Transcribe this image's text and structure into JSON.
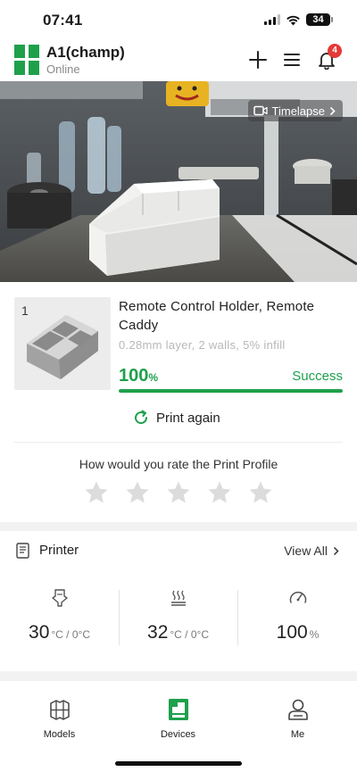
{
  "status_bar": {
    "time": "07:41",
    "battery": "34"
  },
  "header": {
    "printer_name": "A1(champ)",
    "printer_status": "Online",
    "notification_count": "4",
    "icons": [
      "add-icon",
      "menu-icon",
      "bell-icon"
    ]
  },
  "camera": {
    "timelapse_label": "Timelapse"
  },
  "job": {
    "index": "1",
    "title": "Remote Control Holder, Remote Caddy",
    "meta": "0.28mm layer, 2 walls, 5% infill",
    "progress_value": "100",
    "progress_unit": "%",
    "progress_fraction": 1.0,
    "result": "Success",
    "print_again_label": "Print again"
  },
  "rating": {
    "prompt": "How would you rate the Print Profile",
    "star_count": 5,
    "selected": 0
  },
  "printer_section": {
    "title": "Printer",
    "view_all_label": "View All",
    "temperatures": [
      {
        "icon": "nozzle-icon",
        "value": "30",
        "sub": "°C / 0°C"
      },
      {
        "icon": "heatbed-icon",
        "value": "32",
        "sub": "°C / 0°C"
      },
      {
        "icon": "fan-speed-icon",
        "value": "100",
        "sub": "%"
      }
    ]
  },
  "tabs": [
    {
      "label": "Models",
      "icon": "models-icon",
      "active": false
    },
    {
      "label": "Devices",
      "icon": "devices-icon",
      "active": true
    },
    {
      "label": "Me",
      "icon": "profile-icon",
      "active": false
    }
  ],
  "colors": {
    "accent": "#1ea04b",
    "badge": "#e53935",
    "muted": "#b8b8b8"
  }
}
